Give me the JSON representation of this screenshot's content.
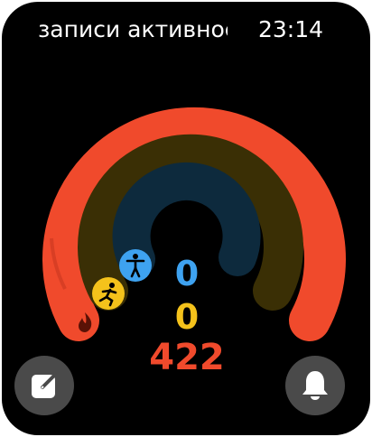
{
  "status": {
    "title": "записи активнос",
    "time": "23:14"
  },
  "activity": {
    "move_value": "422",
    "exercise_value": "0",
    "stand_value": "0"
  },
  "colors": {
    "move": "#f04a2c",
    "exercise": "#f4c21b",
    "stand": "#3ea2f0"
  },
  "icons": {
    "move": "flame-icon",
    "exercise": "running-person-icon",
    "stand": "standing-person-icon",
    "left_button": "edit-icon",
    "right_button": "bell-icon"
  }
}
